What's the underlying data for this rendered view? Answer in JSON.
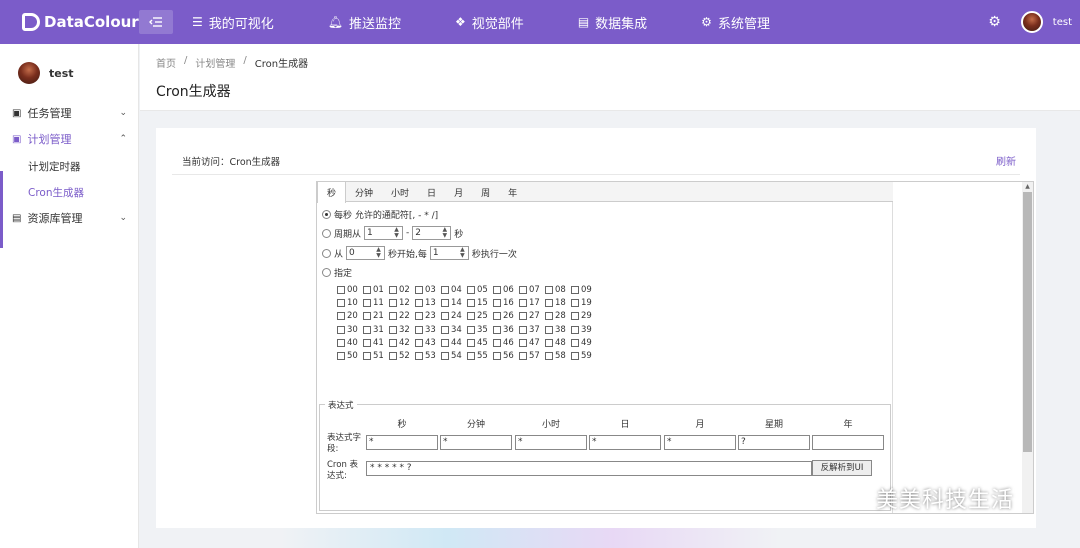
{
  "app": {
    "logo": "DataColour",
    "user": "test"
  },
  "nav": [
    {
      "icon": "list-icon",
      "glyph": "☰",
      "label": "我的可视化"
    },
    {
      "icon": "bell-icon",
      "glyph": "🔔︎",
      "label": "推送监控"
    },
    {
      "icon": "gem-icon",
      "glyph": "❖",
      "label": "视觉部件"
    },
    {
      "icon": "database-icon",
      "glyph": "▤",
      "label": "数据集成"
    },
    {
      "icon": "gear-icon",
      "glyph": "⚙",
      "label": "系统管理"
    }
  ],
  "sidebar": {
    "user": "test",
    "items": [
      {
        "label": "任务管理"
      },
      {
        "label": "计划管理"
      },
      {
        "label": "计划定时器"
      },
      {
        "label": "Cron生成器"
      },
      {
        "label": "资源库管理"
      }
    ]
  },
  "breadcrumb": {
    "home": "首页",
    "section": "计划管理",
    "current": "Cron生成器"
  },
  "page_title": "Cron生成器",
  "card": {
    "visit_label": "当前访问：Cron生成器",
    "refresh": "刷新"
  },
  "tabs": [
    "秒",
    "分钟",
    "小时",
    "日",
    "月",
    "周",
    "年"
  ],
  "options": {
    "every": "每秒 允许的通配符[, - * /]",
    "cycle_prefix": "周期从",
    "cycle_from": "1",
    "cycle_dash": "-",
    "cycle_to": "2",
    "cycle_suffix": "秒",
    "from_prefix": "从",
    "from_start": "0",
    "from_mid": "秒开始,每",
    "from_step": "1",
    "from_suffix": "秒执行一次",
    "specify": "指定"
  },
  "seconds": [
    "00",
    "01",
    "02",
    "03",
    "04",
    "05",
    "06",
    "07",
    "08",
    "09",
    "10",
    "11",
    "12",
    "13",
    "14",
    "15",
    "16",
    "17",
    "18",
    "19",
    "20",
    "21",
    "22",
    "23",
    "24",
    "25",
    "26",
    "27",
    "28",
    "29",
    "30",
    "31",
    "32",
    "33",
    "34",
    "35",
    "36",
    "37",
    "38",
    "39",
    "40",
    "41",
    "42",
    "43",
    "44",
    "45",
    "46",
    "47",
    "48",
    "49",
    "50",
    "51",
    "52",
    "53",
    "54",
    "55",
    "56",
    "57",
    "58",
    "59"
  ],
  "expression": {
    "legend": "表达式",
    "headers": [
      "秒",
      "分钟",
      "小时",
      "日",
      "月",
      "星期",
      "年"
    ],
    "field_label": "表达式字段:",
    "values": [
      "*",
      "*",
      "*",
      "*",
      "*",
      "?",
      ""
    ],
    "cron_label": "Cron 表达式:",
    "cron_value": "* * * * * ?",
    "parse_button": "反解析到UI"
  },
  "watermark": "美美科技生活"
}
